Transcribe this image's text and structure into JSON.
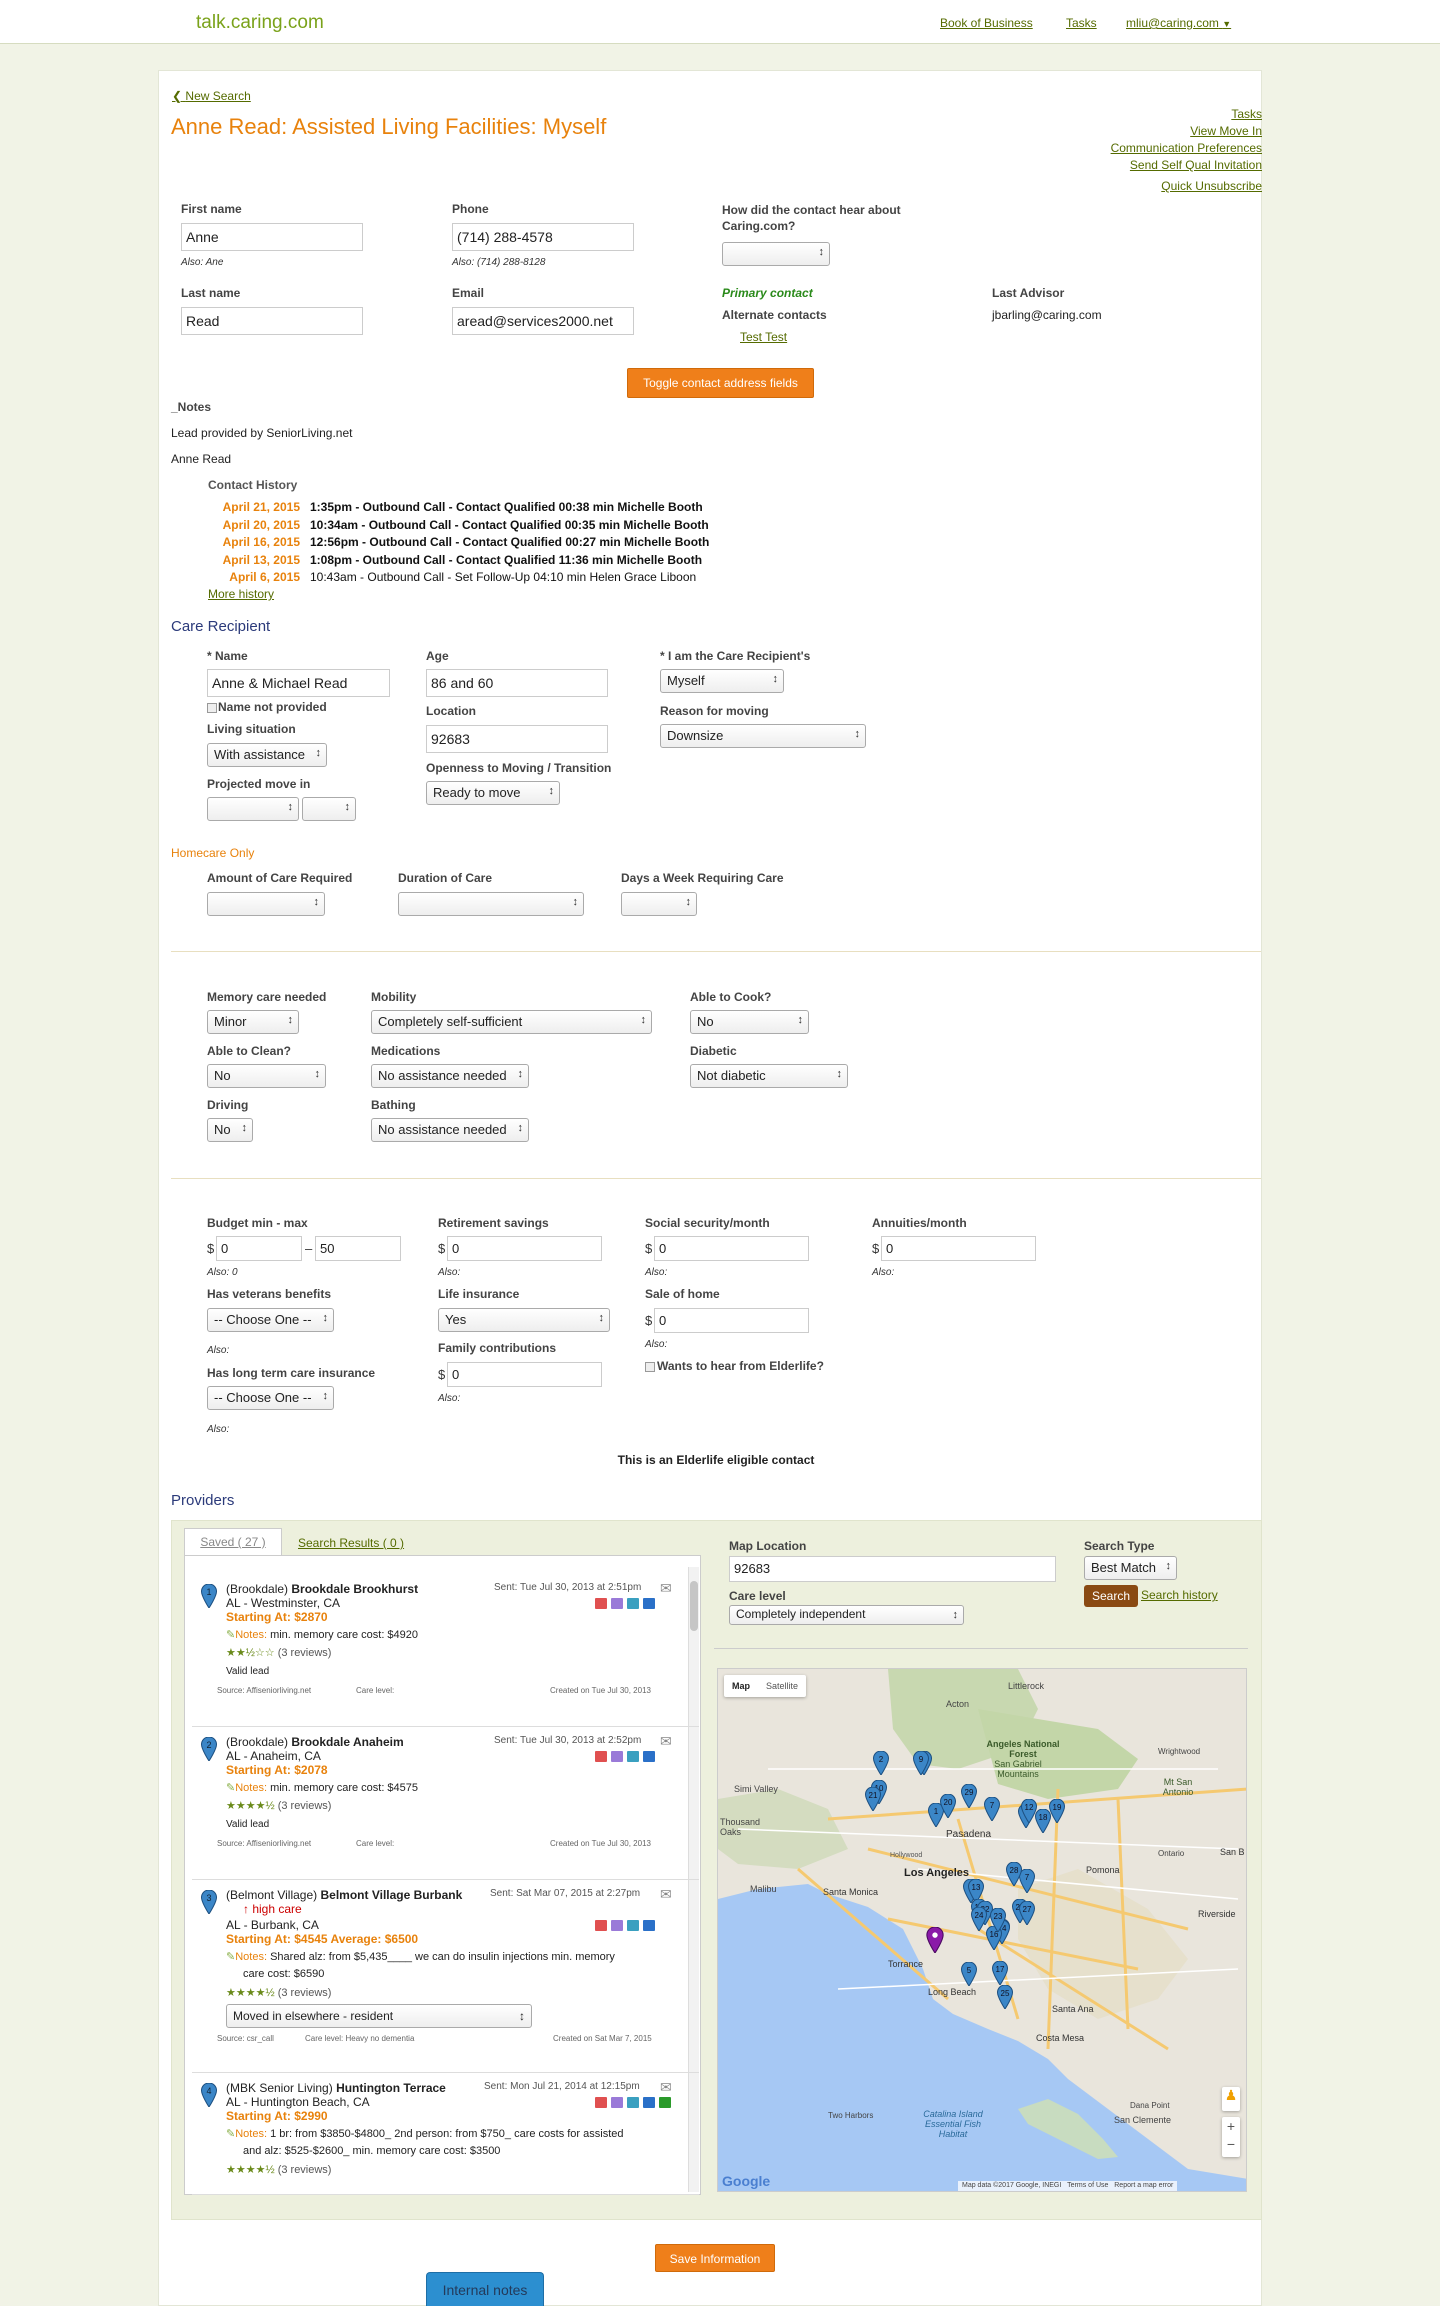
{
  "topbar": {
    "brand": "talk.caring.com",
    "links": [
      "Book of Business",
      "Tasks"
    ],
    "user": "mliu@caring.com"
  },
  "header": {
    "back": "New Search",
    "title": "Anne Read: Assisted Living Facilities: Myself",
    "actions": [
      "Tasks",
      "View Move In",
      "Communication Preferences",
      "Send Self Qual Invitation",
      "Quick Unsubscribe"
    ]
  },
  "contact": {
    "first_name_label": "First name",
    "first_name": "Anne",
    "first_also": "Also: Ane",
    "phone_label": "Phone",
    "phone": "(714) 288-4578",
    "phone_also": "Also: (714) 288-8128",
    "hear_label": "How did the contact hear about Caring.com?",
    "last_name_label": "Last name",
    "last_name": "Read",
    "email_label": "Email",
    "email": "aread@services2000.net",
    "primary": "Primary contact",
    "alternate": "Alternate contacts",
    "alt_link": "Test Test",
    "advisor_label": "Last Advisor",
    "advisor": "jbarling@caring.com",
    "toggle_btn": "Toggle contact address fields"
  },
  "notes": {
    "heading": "_Notes",
    "line1": "Lead provided by SeniorLiving.net",
    "line2": "Anne Read",
    "history_label": "Contact History",
    "history": [
      {
        "date": "April 21, 2015",
        "text": "1:35pm - Outbound Call - Contact Qualified 00:38 min Michelle Booth",
        "bold": true
      },
      {
        "date": "April 20, 2015",
        "text": "10:34am - Outbound Call - Contact Qualified 00:35 min Michelle Booth",
        "bold": true
      },
      {
        "date": "April 16, 2015",
        "text": "12:56pm - Outbound Call - Contact Qualified 00:27 min Michelle Booth",
        "bold": true
      },
      {
        "date": "April 13, 2015",
        "text": "1:08pm - Outbound Call - Contact Qualified 11:36 min Michelle Booth",
        "bold": true
      },
      {
        "date": "April 6, 2015",
        "text": "10:43am - Outbound Call - Set Follow-Up 04:10 min Helen Grace Liboon",
        "bold": false
      }
    ],
    "more": "More history"
  },
  "care": {
    "heading": "Care Recipient",
    "name_label": "* Name",
    "name": "Anne & Michael Read",
    "name_np": "Name not provided",
    "age_label": "Age",
    "age": "86 and 60",
    "iam_label": "* I am the Care Recipient's",
    "iam": "Myself",
    "living_label": "Living situation",
    "living": "With assistance",
    "location_label": "Location",
    "location": "92683",
    "reason_label": "Reason for moving",
    "reason": "Downsize",
    "proj_label": "Projected move in",
    "openness_label": "Openness to Moving / Transition",
    "openness": "Ready to move"
  },
  "homecare": {
    "heading": "Homecare Only",
    "amount_label": "Amount of Care Required",
    "duration_label": "Duration of Care",
    "days_label": "Days a Week Requiring Care"
  },
  "needs": {
    "memory_label": "Memory care needed",
    "memory": "Minor",
    "mobility_label": "Mobility",
    "mobility": "Completely self-sufficient",
    "cook_label": "Able to Cook?",
    "cook": "No",
    "clean_label": "Able to Clean?",
    "clean": "No",
    "meds_label": "Medications",
    "meds": "No assistance needed",
    "diabetic_label": "Diabetic",
    "diabetic": "Not diabetic",
    "driving_label": "Driving",
    "driving": "No",
    "bathing_label": "Bathing",
    "bathing": "No assistance needed"
  },
  "finance": {
    "budget_label": "Budget min - max",
    "budget_min": "0",
    "budget_max": "50",
    "budget_also": "Also: 0",
    "retire_label": "Retirement savings",
    "retire": "0",
    "ss_label": "Social security/month",
    "ss": "0",
    "ann_label": "Annuities/month",
    "ann": "0",
    "also": "Also:",
    "vet_label": "Has veterans benefits",
    "vet": "-- Choose One --",
    "life_label": "Life insurance",
    "life": "Yes",
    "sale_label": "Sale of home",
    "sale": "0",
    "family_label": "Family contributions",
    "family": "0",
    "elder_q": "Wants to hear from Elderlife?",
    "ltc_label": "Has long term care insurance",
    "ltc": "-- Choose One --",
    "dollar": "$",
    "dash": "–",
    "elderlife": "This is an Elderlife eligible contact"
  },
  "providers": {
    "heading": "Providers",
    "tab_saved": "Saved ( 27 )",
    "tab_results": "Search Results ( 0 )",
    "list": [
      {
        "num": "1",
        "group": "(Brookdale)",
        "name": "Brookdale Brookhurst",
        "loc": "AL - Westminster, CA",
        "sent": "Sent: Tue Jul 30, 2013 at 2:51pm",
        "price": "Starting At: $2870",
        "notes_label": "Notes:",
        "notes": "min. memory care cost: $4920",
        "stars": "★★½☆☆",
        "reviews": "(3 reviews)",
        "extra": "Valid lead",
        "source": "Source: Affiseniorliving.net",
        "level": "Care level:",
        "created": "Created on Tue Jul 30, 2013"
      },
      {
        "num": "2",
        "group": "(Brookdale)",
        "name": "Brookdale Anaheim",
        "loc": "AL - Anaheim, CA",
        "sent": "Sent: Tue Jul 30, 2013 at 2:52pm",
        "price": "Starting At: $2078",
        "notes_label": "Notes:",
        "notes": "min. memory care cost: $4575",
        "stars": "★★★★½",
        "reviews": "(3 reviews)",
        "extra": "Valid lead",
        "source": "Source: Affiseniorliving.net",
        "level": "Care level:",
        "created": "Created on Tue Jul 30, 2013"
      },
      {
        "num": "3",
        "group": "(Belmont Village)",
        "name": "Belmont Village Burbank",
        "loc": "AL - Burbank, CA",
        "sent": "Sent: Sat Mar 07, 2015 at 2:27pm",
        "high": "high care",
        "price": "Starting At: $4545 Average: $6500",
        "notes_label": "Notes:",
        "notes": "Shared alz: from $5,435____ we can do insulin injections min. memory",
        "notes2": "care cost: $6590",
        "stars": "★★★★½",
        "reviews": "(3 reviews)",
        "status": "Moved in elsewhere - resident",
        "source": "Source: csr_call",
        "level": "Care level: Heavy no dementia",
        "created": "Created on Sat Mar 7, 2015"
      },
      {
        "num": "4",
        "group": "(MBK Senior Living)",
        "name": "Huntington Terrace",
        "loc": "AL - Huntington Beach, CA",
        "sent": "Sent: Mon Jul 21, 2014 at 12:15pm",
        "price": "Starting At: $2990",
        "notes_label": "Notes:",
        "notes": "1 br: from $3850-$4800_ 2nd person: from $750_ care costs for assisted",
        "notes2": "and alz: $525-$2600_ min. memory care cost: $3500",
        "stars": "★★★★½",
        "reviews": "(3 reviews)"
      }
    ],
    "map_location_label": "Map Location",
    "map_location": "92683",
    "search_type_label": "Search Type",
    "search_type": "Best Match",
    "care_level_label": "Care level",
    "care_level": "Completely independent",
    "search_btn": "Search",
    "history_link": "Search history",
    "map_tabs": [
      "Map",
      "Satellite"
    ],
    "map_places": [
      "Littlerock",
      "Acton",
      "Angeles National Forest",
      "San Gabriel Mountains",
      "Wrightwood",
      "Mt San Antonio",
      "Simi Valley",
      "Thousand Oaks",
      "Pasadena",
      "Los Angeles",
      "Pomona",
      "Malibu",
      "Santa Monica",
      "Torrance",
      "Long Beach",
      "Santa Ana",
      "Costa Mesa",
      "Riverside",
      "Two Harbors",
      "Catalina Island Essential Fish Habitat",
      "Dana Point",
      "San Clemente",
      "San B",
      "Hollywood",
      "Ontario"
    ],
    "map_footer": "Map data ©2017 Google, INEGI",
    "map_terms": "Terms of Use",
    "map_report": "Report a map error",
    "google": "Google"
  },
  "save_btn": "Save Information",
  "internal_notes": "Internal notes",
  "colors": {
    "accent": "#ef7f1a",
    "link": "#556b00",
    "title": "#e8820c",
    "pin": "#3b86c7"
  }
}
